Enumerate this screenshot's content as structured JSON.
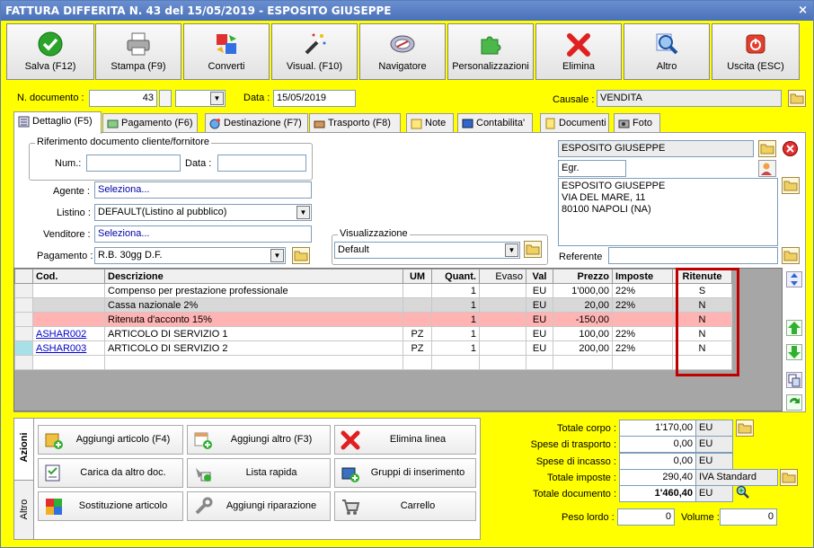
{
  "window": {
    "title": "FATTURA DIFFERITA N. 43 del 15/05/2019 - ESPOSITO GIUSEPPE",
    "close": "×"
  },
  "toolbar": [
    {
      "label": "Salva (F12)",
      "icon": "check-icon"
    },
    {
      "label": "Stampa (F9)",
      "icon": "printer-icon"
    },
    {
      "label": "Converti",
      "icon": "convert-icon"
    },
    {
      "label": "Visual. (F10)",
      "icon": "magic-wand-icon"
    },
    {
      "label": "Navigatore",
      "icon": "compass-icon"
    },
    {
      "label": "Personalizzazioni",
      "icon": "puzzle-icon"
    },
    {
      "label": "Elimina",
      "icon": "delete-x-icon"
    },
    {
      "label": "Altro",
      "icon": "magnifier-icon"
    },
    {
      "label": "Uscita (ESC)",
      "icon": "power-icon"
    }
  ],
  "header": {
    "num_label": "N. documento :",
    "num_value": "43",
    "data_label": "Data :",
    "data_value": "15/05/2019",
    "causale_label": "Causale :",
    "causale_value": "VENDITA"
  },
  "tabs": [
    {
      "label": "Dettaglio (F5)",
      "active": true
    },
    {
      "label": "Pagamento (F6)"
    },
    {
      "label": "Destinazione (F7)"
    },
    {
      "label": "Trasporto (F8)"
    },
    {
      "label": "Note"
    },
    {
      "label": "Contabilita'"
    },
    {
      "label": "Documenti"
    },
    {
      "label": "Foto"
    }
  ],
  "riferimento": {
    "title": "Riferimento documento cliente/fornitore",
    "num_label": "Num.:",
    "num_value": "",
    "data_label": "Data :",
    "data_value": ""
  },
  "fields": {
    "agente_label": "Agente :",
    "agente_value": "Seleziona...",
    "listino_label": "Listino :",
    "listino_value": "DEFAULT(Listino al pubblico)",
    "venditore_label": "Venditore :",
    "venditore_value": "Seleziona...",
    "pagamento_label": "Pagamento :",
    "pagamento_value": "R.B. 30gg D.F."
  },
  "visualizzazione": {
    "title": "Visualizzazione",
    "value": "Default"
  },
  "cliente": {
    "nome": "ESPOSITO GIUSEPPE",
    "titolo": "Egr.",
    "indirizzo_1": "ESPOSITO GIUSEPPE",
    "indirizzo_2": "VIA DEL MARE, 11",
    "indirizzo_3": "80100 NAPOLI (NA)",
    "referente_label": "Referente",
    "referente_value": ""
  },
  "table": {
    "headers": [
      "Cod.",
      "Descrizione",
      "UM",
      "Quant.",
      "Evaso",
      "Val",
      "Prezzo",
      "Imposte",
      "Ritenute"
    ],
    "rows": [
      {
        "cod": "",
        "desc": "Compenso per prestazione professionale",
        "um": "",
        "qty": "1",
        "evaso": "",
        "val": "EU",
        "prezzo": "1'000,00",
        "imposte": "22%",
        "ritenute": "S",
        "bg": "#ffffff",
        "link": false
      },
      {
        "cod": "",
        "desc": "Cassa nazionale 2%",
        "um": "",
        "qty": "1",
        "evaso": "",
        "val": "EU",
        "prezzo": "20,00",
        "imposte": "22%",
        "ritenute": "N",
        "bg": "#d8d8d8",
        "link": false
      },
      {
        "cod": "",
        "desc": "Ritenuta d'acconto 15%",
        "um": "",
        "qty": "1",
        "evaso": "",
        "val": "EU",
        "prezzo": "-150,00",
        "imposte": "",
        "ritenute": "N",
        "bg": "#ffb3b3",
        "link": false
      },
      {
        "cod": "ASHAR002",
        "desc": "ARTICOLO DI SERVIZIO 1",
        "um": "PZ",
        "qty": "1",
        "evaso": "",
        "val": "EU",
        "prezzo": "100,00",
        "imposte": "22%",
        "ritenute": "N",
        "bg": "#ffffff",
        "link": true
      },
      {
        "cod": "ASHAR003",
        "desc": "ARTICOLO DI SERVIZIO 2",
        "um": "PZ",
        "qty": "1",
        "evaso": "",
        "val": "EU",
        "prezzo": "200,00",
        "imposte": "22%",
        "ritenute": "N",
        "bg": "#ffffff",
        "link": true
      },
      {
        "cod": "",
        "desc": "",
        "um": "",
        "qty": "",
        "evaso": "",
        "val": "",
        "prezzo": "",
        "imposte": "",
        "ritenute": "",
        "bg": "#ffffff",
        "link": false
      }
    ]
  },
  "side_tabs": {
    "azioni": "Azioni",
    "altro": "Altro"
  },
  "actions": [
    {
      "label": "Aggiungi articolo (F4)",
      "icon": "add-article-icon"
    },
    {
      "label": "Aggiungi altro (F3)",
      "icon": "add-other-icon"
    },
    {
      "label": "Elimina linea",
      "icon": "delete-line-icon"
    },
    {
      "label": "Carica da altro doc.",
      "icon": "load-doc-icon"
    },
    {
      "label": "Lista rapida",
      "icon": "quick-list-icon"
    },
    {
      "label": "Gruppi di inserimento",
      "icon": "insert-groups-icon"
    },
    {
      "label": "Sostituzione articolo",
      "icon": "replace-article-icon"
    },
    {
      "label": "Aggiungi riparazione",
      "icon": "repair-icon"
    },
    {
      "label": "Carrello",
      "icon": "cart-icon"
    }
  ],
  "totals": {
    "corpo_label": "Totale corpo :",
    "corpo_value": "1'170,00",
    "corpo_cur": "EU",
    "trasporto_label": "Spese di trasporto :",
    "trasporto_value": "0,00",
    "trasporto_cur": "EU",
    "incasso_label": "Spese di incasso :",
    "incasso_value": "0,00",
    "incasso_cur": "EU",
    "imposte_label": "Totale imposte :",
    "imposte_value": "290,40",
    "imposte_cur": "IVA Standard",
    "documento_label": "Totale documento :",
    "documento_value": "1'460,40",
    "documento_cur": "EU",
    "peso_label": "Peso lordo :",
    "peso_value": "0",
    "volume_label": "Volume :",
    "volume_value": "0"
  }
}
